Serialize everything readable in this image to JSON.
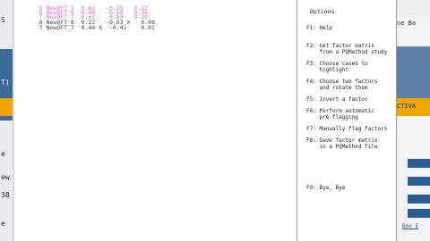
{
  "left_strip": {
    "texts": [
      "S",
      "T)",
      "e",
      "ew",
      "38",
      "e"
    ]
  },
  "factor_rows": [
    {
      "num": "5",
      "name": "NewQFT_5",
      "v1": "0.63",
      "v2": "-0.79",
      "v3": "0.22"
    },
    {
      "num": "6",
      "name": "NewQFT_6",
      "v1": "0.44",
      "v2": "-0.59",
      "v3": "0.36"
    },
    {
      "num": "7",
      "name": "NewQFT_7",
      "v1": "0.62",
      "v2": "-0.63",
      "v3": "0.16"
    },
    {
      "num": "8",
      "name": "NewQFT_8",
      "v1": "0.22",
      "v2": "-0.63 X",
      "v3": "0.08"
    },
    {
      "num": "7",
      "name": "NewQFT_7",
      "v1": "0.44 X",
      "v2": "-0.41",
      "v3": "0.01"
    }
  ],
  "options_panel": {
    "title": "Options",
    "items": [
      {
        "key": "F1:",
        "text": "Help"
      },
      {
        "key": "F2:",
        "text": "Get factor matrix\nfrom a PQMethod study"
      },
      {
        "key": "F3:",
        "text": "Choose cases to\nhighlight"
      },
      {
        "key": "F4:",
        "text": "Choose two factors\nand rotate them"
      },
      {
        "key": "F5:",
        "text": "Invert a factor"
      },
      {
        "key": "F6:",
        "text": "Perform automatic\npre-flagging"
      },
      {
        "key": "F7:",
        "text": "Manually flag factors"
      },
      {
        "key": "F8:",
        "text": "Save factor matrix\nin a PQMethod file"
      },
      {
        "key": "F9:",
        "text": "Bye, Bye"
      }
    ]
  },
  "right_strip": {
    "top_text": "ne Ba",
    "orange_text": "CTIVA",
    "link_text": "Box E"
  }
}
